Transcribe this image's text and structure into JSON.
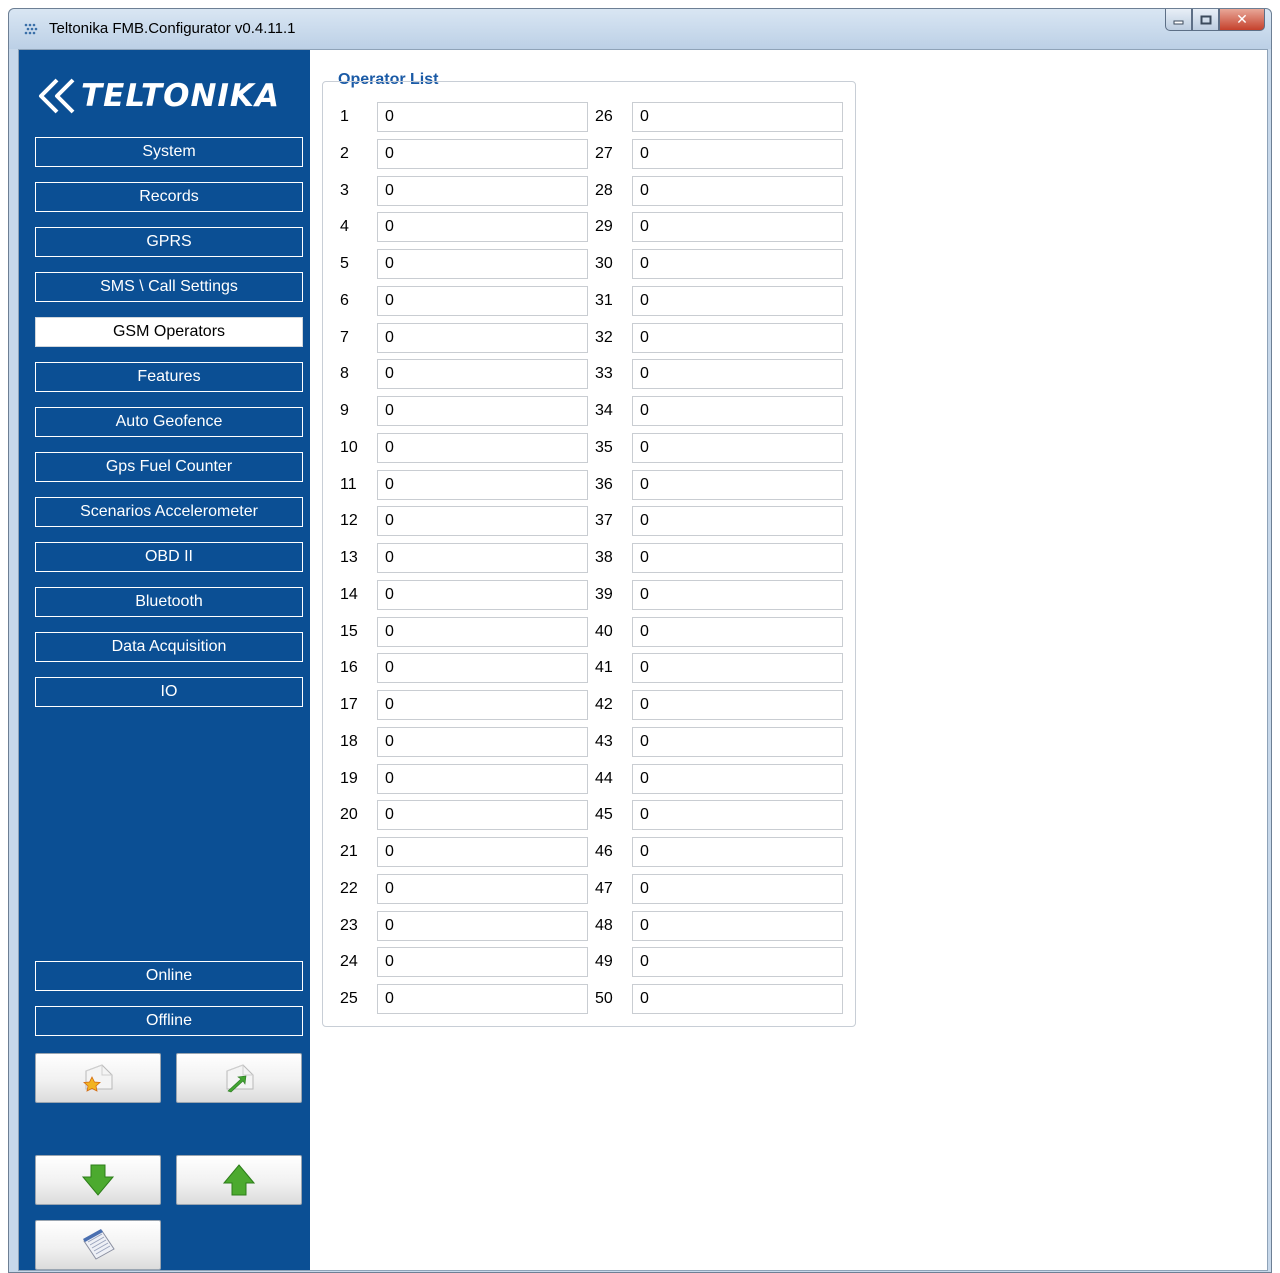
{
  "window": {
    "title": "Teltonika FMB.Configurator v0.4.11.1"
  },
  "logo": {
    "text": "TELTONIKA"
  },
  "nav": [
    {
      "label": "System",
      "active": false
    },
    {
      "label": "Records",
      "active": false
    },
    {
      "label": "GPRS",
      "active": false
    },
    {
      "label": "SMS \\ Call Settings",
      "active": false
    },
    {
      "label": "GSM Operators",
      "active": true
    },
    {
      "label": "Features",
      "active": false
    },
    {
      "label": "Auto Geofence",
      "active": false
    },
    {
      "label": "Gps Fuel Counter",
      "active": false
    },
    {
      "label": "Scenarios Accelerometer",
      "active": false
    },
    {
      "label": "OBD II",
      "active": false
    },
    {
      "label": "Bluetooth",
      "active": false
    },
    {
      "label": "Data Acquisition",
      "active": false
    },
    {
      "label": "IO",
      "active": false
    }
  ],
  "connection": {
    "online_label": "Online",
    "offline_label": "Offline"
  },
  "tools": {
    "load_icon": "folder-load-icon",
    "save_icon": "folder-save-icon",
    "download_icon": "arrow-down-icon",
    "upload_icon": "arrow-up-icon",
    "log_icon": "notepad-icon"
  },
  "operator_list": {
    "title": "Operator List",
    "rows": [
      {
        "num": "1",
        "value": "0"
      },
      {
        "num": "2",
        "value": "0"
      },
      {
        "num": "3",
        "value": "0"
      },
      {
        "num": "4",
        "value": "0"
      },
      {
        "num": "5",
        "value": "0"
      },
      {
        "num": "6",
        "value": "0"
      },
      {
        "num": "7",
        "value": "0"
      },
      {
        "num": "8",
        "value": "0"
      },
      {
        "num": "9",
        "value": "0"
      },
      {
        "num": "10",
        "value": "0"
      },
      {
        "num": "11",
        "value": "0"
      },
      {
        "num": "12",
        "value": "0"
      },
      {
        "num": "13",
        "value": "0"
      },
      {
        "num": "14",
        "value": "0"
      },
      {
        "num": "15",
        "value": "0"
      },
      {
        "num": "16",
        "value": "0"
      },
      {
        "num": "17",
        "value": "0"
      },
      {
        "num": "18",
        "value": "0"
      },
      {
        "num": "19",
        "value": "0"
      },
      {
        "num": "20",
        "value": "0"
      },
      {
        "num": "21",
        "value": "0"
      },
      {
        "num": "22",
        "value": "0"
      },
      {
        "num": "23",
        "value": "0"
      },
      {
        "num": "24",
        "value": "0"
      },
      {
        "num": "25",
        "value": "0"
      },
      {
        "num": "26",
        "value": "0"
      },
      {
        "num": "27",
        "value": "0"
      },
      {
        "num": "28",
        "value": "0"
      },
      {
        "num": "29",
        "value": "0"
      },
      {
        "num": "30",
        "value": "0"
      },
      {
        "num": "31",
        "value": "0"
      },
      {
        "num": "32",
        "value": "0"
      },
      {
        "num": "33",
        "value": "0"
      },
      {
        "num": "34",
        "value": "0"
      },
      {
        "num": "35",
        "value": "0"
      },
      {
        "num": "36",
        "value": "0"
      },
      {
        "num": "37",
        "value": "0"
      },
      {
        "num": "38",
        "value": "0"
      },
      {
        "num": "39",
        "value": "0"
      },
      {
        "num": "40",
        "value": "0"
      },
      {
        "num": "41",
        "value": "0"
      },
      {
        "num": "42",
        "value": "0"
      },
      {
        "num": "43",
        "value": "0"
      },
      {
        "num": "44",
        "value": "0"
      },
      {
        "num": "45",
        "value": "0"
      },
      {
        "num": "46",
        "value": "0"
      },
      {
        "num": "47",
        "value": "0"
      },
      {
        "num": "48",
        "value": "0"
      },
      {
        "num": "49",
        "value": "0"
      },
      {
        "num": "50",
        "value": "0"
      }
    ]
  }
}
